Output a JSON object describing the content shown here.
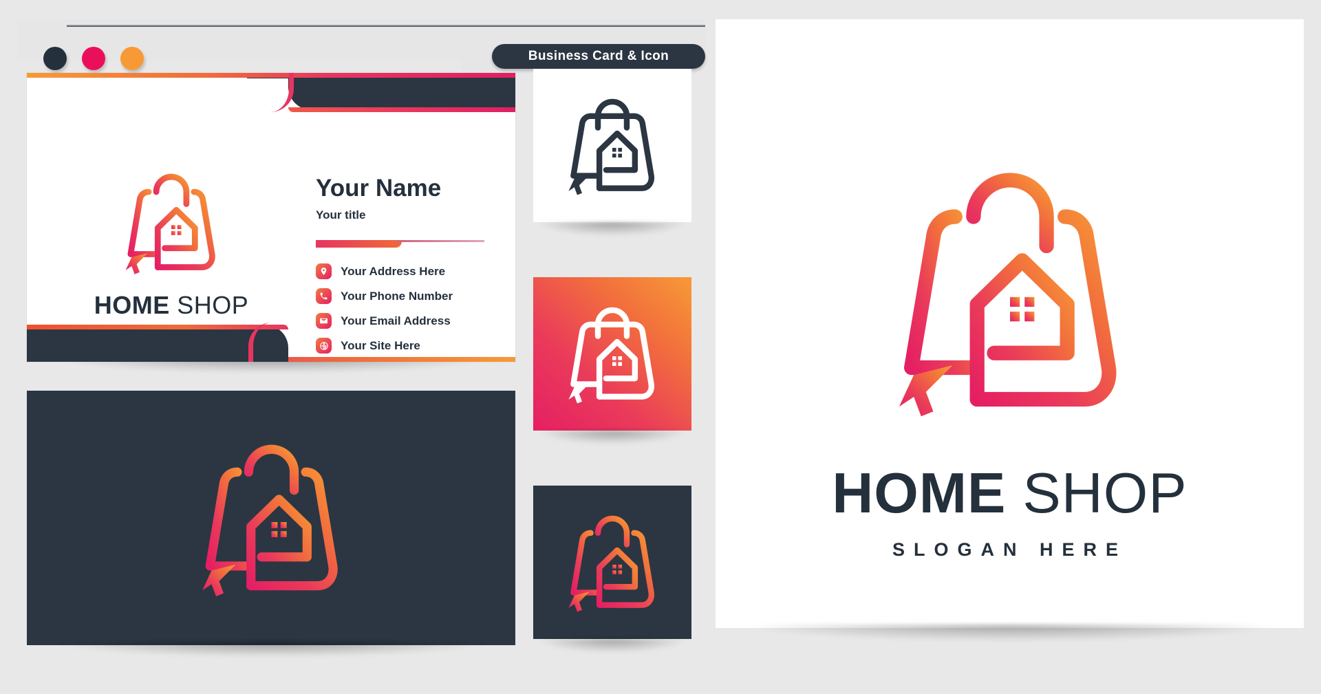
{
  "window": {
    "tab_title": "Business Card & Icon",
    "dots": [
      {
        "name": "dot-dark",
        "color": "#24303c"
      },
      {
        "name": "dot-pink",
        "color": "#ea0f5b"
      },
      {
        "name": "dot-orange",
        "color": "#f79a36"
      }
    ]
  },
  "brand": {
    "name_bold": "HOME",
    "name_light": "SHOP",
    "slogan": "SLOGAN HERE",
    "logo_icon": "shopping-bag-house-cursor-logo",
    "gradient_start": "#e51f63",
    "gradient_end": "#f79a36",
    "dark_color": "#2b3642"
  },
  "card_front": {
    "person_name": "Your Name",
    "person_title": "Your title",
    "contacts": [
      {
        "icon": "location-pin-icon",
        "label": "Your Address Here"
      },
      {
        "icon": "phone-icon",
        "label": "Your Phone Number"
      },
      {
        "icon": "envelope-icon",
        "label": "Your Email Address"
      },
      {
        "icon": "globe-cursor-icon",
        "label": "Your Site Here"
      }
    ]
  },
  "icon_variants": [
    {
      "name": "icon-variant-white",
      "background": "#ffffff",
      "mark_style": "dark"
    },
    {
      "name": "icon-variant-gradient",
      "background": "gradient",
      "mark_style": "white"
    },
    {
      "name": "icon-variant-dark",
      "background": "#2b3642",
      "mark_style": "gradient"
    }
  ],
  "right_panel": {
    "name_bold": "HOME",
    "name_light": "SHOP",
    "slogan": "SLOGAN HERE"
  }
}
